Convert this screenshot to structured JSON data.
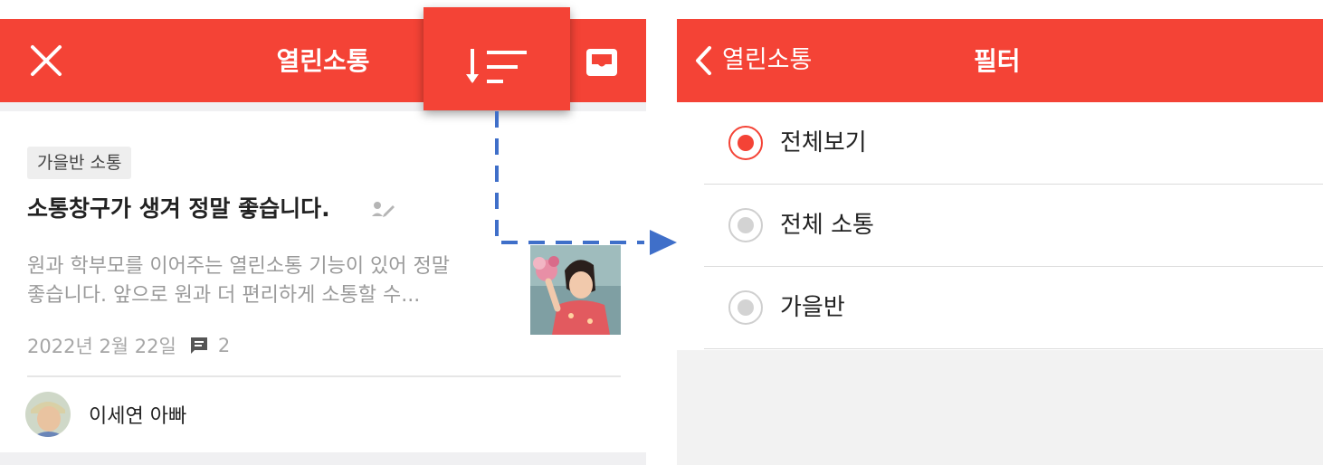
{
  "left": {
    "header": {
      "title": "열린소통"
    },
    "post": {
      "class_tag": "가을반 소통",
      "title": "소통창구가 생겨 정말 좋습니다.",
      "body_line1": "원과 학부모를 이어주는 열린소통 기능이 있어 정말",
      "body_line2": "좋습니다. 앞으로 원과 더 편리하게 소통할 수...",
      "date": "2022년 2월 22일",
      "comment_count": "2",
      "author": "이세연 아빠"
    }
  },
  "right": {
    "header": {
      "back_label": "열린소통",
      "title": "필터"
    },
    "filters": [
      {
        "label": "전체보기",
        "selected": true
      },
      {
        "label": "전체 소통",
        "selected": false
      },
      {
        "label": "가을반",
        "selected": false
      }
    ]
  },
  "colors": {
    "brand_red": "#f44336",
    "connector_blue": "#3f6fc9"
  },
  "icons": {
    "close": "close-icon",
    "sort": "sort-icon",
    "inbox": "inbox-icon",
    "back": "chevron-left-icon",
    "pencil": "pencil-icon",
    "comment": "comment-icon"
  }
}
